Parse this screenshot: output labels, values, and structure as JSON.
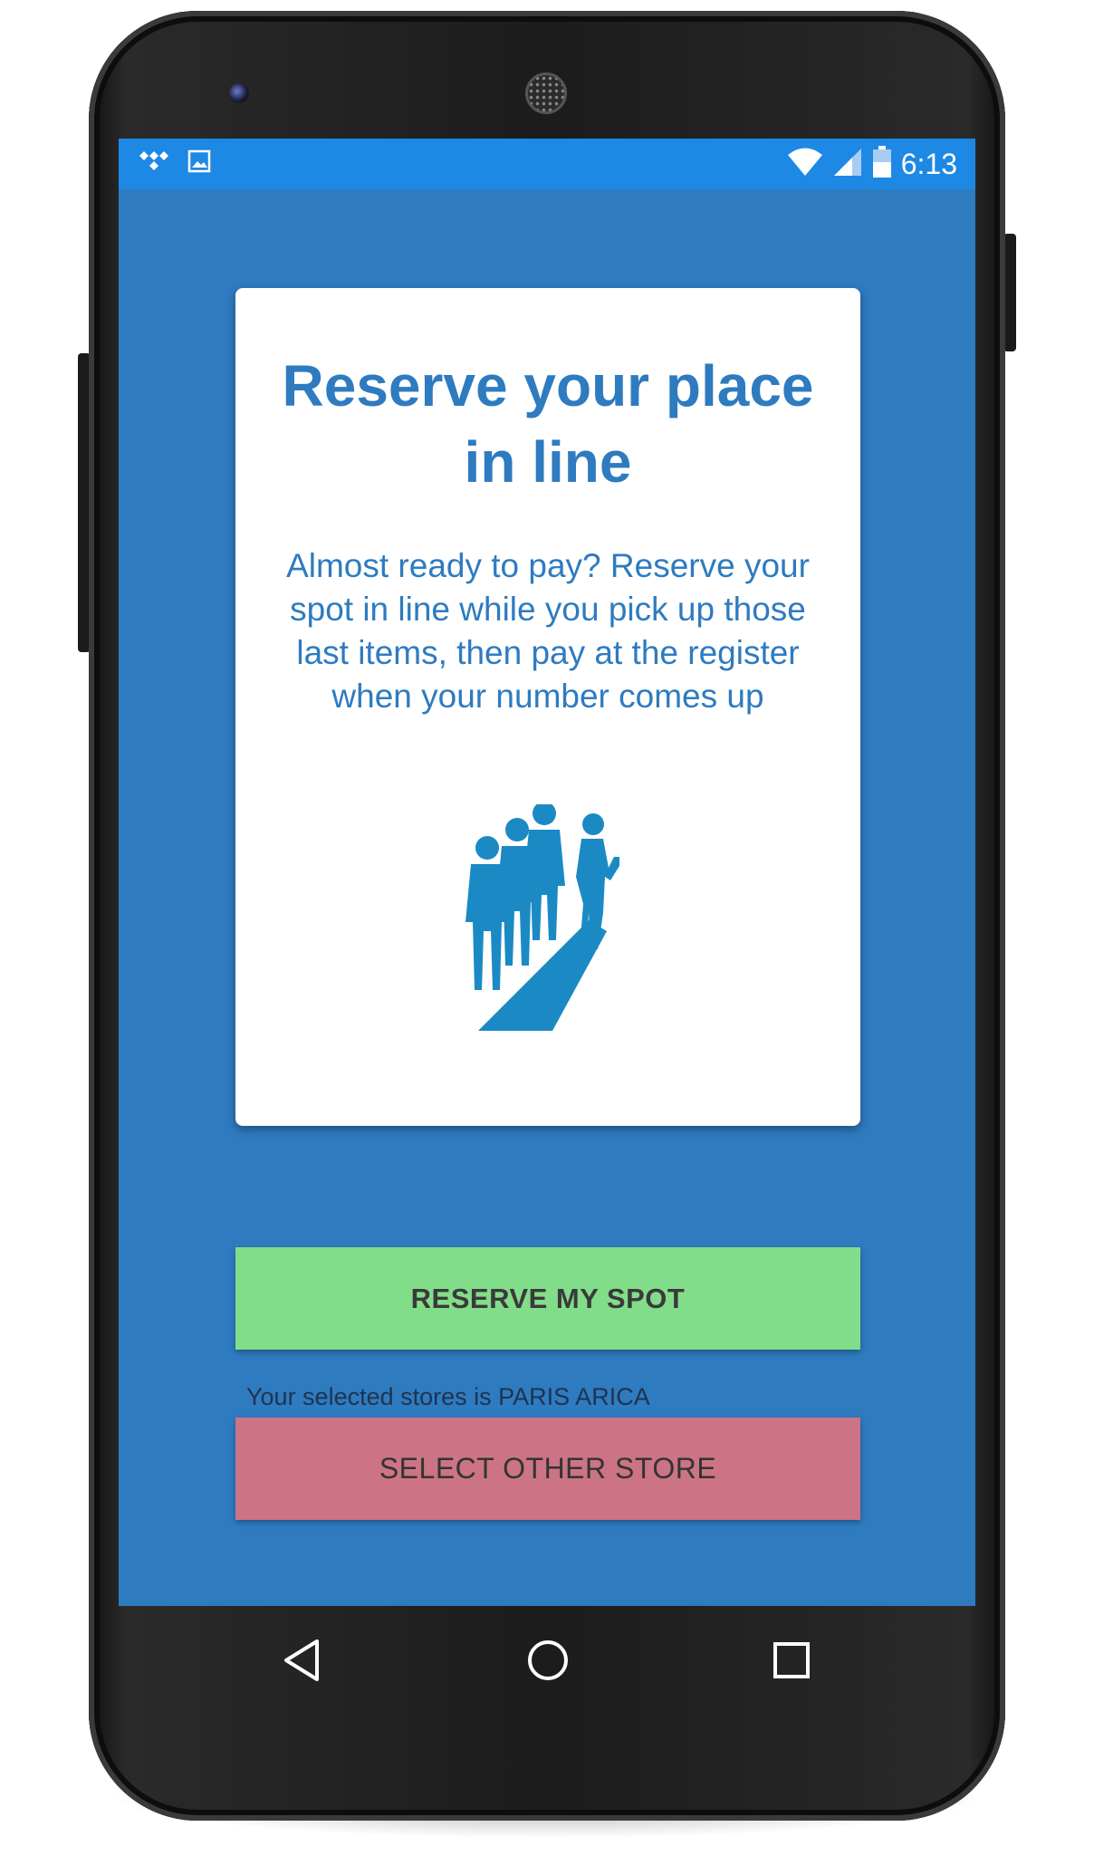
{
  "status_bar": {
    "time": "6:13",
    "icons": [
      "tidal-icon",
      "image-icon",
      "wifi-icon",
      "signal-icon",
      "battery-icon"
    ]
  },
  "card": {
    "title": "Reserve your place in line",
    "body": "Almost ready to pay? Reserve your spot in line while you pick up those last items, then pay at the register when your number comes up",
    "illustration": "people-in-line-icon"
  },
  "actions": {
    "reserve_label": "RESERVE MY SPOT",
    "store_info": "Your selected stores is PARIS ARICA",
    "other_store_label": "SELECT OTHER STORE"
  },
  "navbar": {
    "icons": [
      "back-icon",
      "home-icon",
      "recents-icon"
    ]
  },
  "colors": {
    "background": "#2e7bc0",
    "status_bar": "#1e88e5",
    "card": "#ffffff",
    "title_text": "#2e7bc0",
    "reserve_button": "#82dd8a",
    "other_store_button": "#cc7485",
    "illustration": "#1b8ac4"
  }
}
